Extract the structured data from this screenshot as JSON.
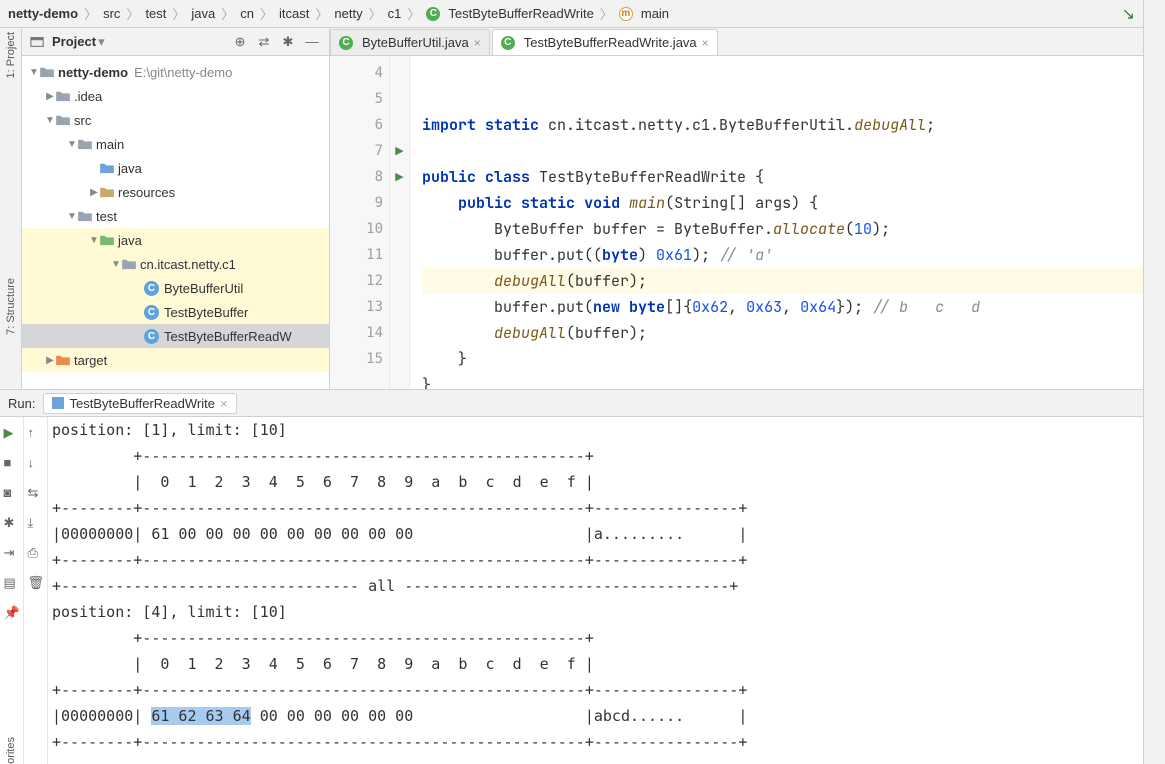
{
  "breadcrumb": {
    "items": [
      "netty-demo",
      "src",
      "test",
      "java",
      "cn",
      "itcast",
      "netty",
      "c1"
    ],
    "class_item": "TestByteBufferReadWrite",
    "method_item": "main"
  },
  "sidebar": {
    "project_label": "1: Project",
    "structure_label": "7: Structure",
    "favorites_label": "orites"
  },
  "project": {
    "title": "Project",
    "root": "netty-demo",
    "root_path": "E:\\git\\netty-demo",
    "nodes": {
      "idea": ".idea",
      "src": "src",
      "main": "main",
      "java1": "java",
      "resources": "resources",
      "test": "test",
      "java2": "java",
      "pkg": "cn.itcast.netty.c1",
      "f1": "ByteBufferUtil",
      "f2": "TestByteBuffer",
      "f3": "TestByteBufferReadW",
      "target": "target"
    }
  },
  "tabs": {
    "t1": "ByteBufferUtil.java",
    "t2": "TestByteBufferReadWrite.java"
  },
  "editor": {
    "gutter_start": 4,
    "gutter_end": 15
  },
  "code": {
    "l5a": "import",
    "l5b": "static",
    "l5c": " cn.itcast.netty.c1.ByteBufferUtil.",
    "l5d": "debugAll",
    "l5e": ";",
    "l7a": "public",
    "l7b": "class",
    "l7c": " TestByteBufferReadWrite {",
    "l8a": "public",
    "l8b": "static",
    "l8c": "void",
    "l8d": "main",
    "l8e": "(String[] args) {",
    "l9a": "        ByteBuffer buffer = ByteBuffer.",
    "l9b": "allocate",
    "l9c": "(",
    "l9d": "10",
    "l9e": ");",
    "l10a": "        buffer.put((",
    "l10b": "byte",
    "l10c": ") ",
    "l10d": "0x61",
    "l10e": "); ",
    "l10f": "// 'a'",
    "l11a": "        ",
    "l11b": "debugAll",
    "l11c": "(buffer);",
    "l12a": "        buffer.put(",
    "l12b": "new",
    "l12c": " ",
    "l12d": "byte",
    "l12e": "[]{",
    "l12f": "0x62",
    "l12g": ", ",
    "l12h": "0x63",
    "l12i": ", ",
    "l12j": "0x64",
    "l12k": "}); ",
    "l12l": "// b   c   d",
    "l13a": "        ",
    "l13b": "debugAll",
    "l13c": "(buffer);",
    "l14": "    }",
    "l15": "}"
  },
  "run": {
    "label": "Run:",
    "tab": "TestByteBufferReadWrite"
  },
  "console": {
    "l1": "position: [1], limit: [10]",
    "l2": "         +-------------------------------------------------+",
    "l3": "         |  0  1  2  3  4  5  6  7  8  9  a  b  c  d  e  f |",
    "l4": "+--------+-------------------------------------------------+----------------+",
    "l5": "|00000000| 61 00 00 00 00 00 00 00 00 00                   |a.........      |",
    "l6": "+--------+-------------------------------------------------+----------------+",
    "l7": "+--------------------------------- all ------------------------------------+",
    "l8": "position: [4], limit: [10]",
    "l9": "         +-------------------------------------------------+",
    "l10": "         |  0  1  2  3  4  5  6  7  8  9  a  b  c  d  e  f |",
    "l11": "+--------+-------------------------------------------------+----------------+",
    "l12a": "|00000000| ",
    "l12b": "61 62 63 64",
    "l12c": " 00 00 00 00 00 00                   |abcd......      |",
    "l13": "+--------+-------------------------------------------------+----------------+"
  }
}
